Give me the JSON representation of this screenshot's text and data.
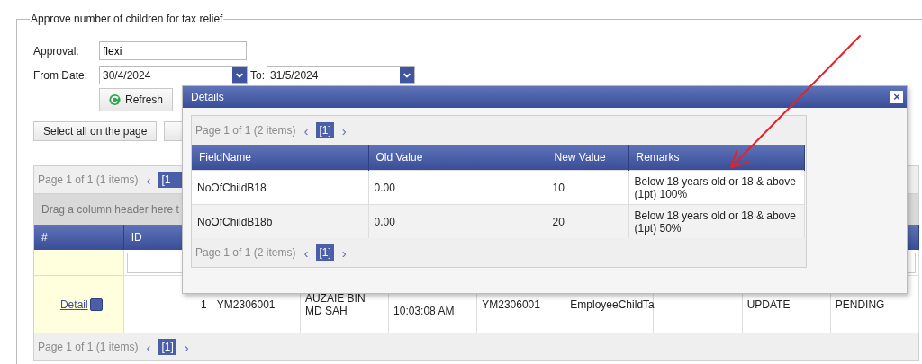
{
  "fieldset": {
    "legend": "Approve number of children for tax relief"
  },
  "form": {
    "approval_label": "Approval:",
    "approval_value": "flexi",
    "from_label": "From Date:",
    "from_value": "30/4/2024",
    "to_label": "To:",
    "to_value": "31/5/2024",
    "refresh": "Refresh"
  },
  "buttons": [
    "Select all on the page"
  ],
  "grid": {
    "pager_top": {
      "summary": "Page 1 of 1 (1 items)",
      "prev": "‹",
      "pages": [
        {
          "label": "[1",
          "selected": true
        }
      ]
    },
    "group_panel": "Drag a column header here t",
    "columns": [
      "#",
      "ID"
    ],
    "rows": [
      {
        "detail_link": "Detail",
        "cells": {
          "column_2": "1",
          "column_3": "YM2306001",
          "column_4": "AUZAIE BIN MD SAH",
          "column_5": "10:03:08 AM",
          "column_6": "YM2306001",
          "column_7": "EmployeeChildTa",
          "column_9": "UPDATE",
          "column_10": "PENDING"
        }
      }
    ],
    "pager_bottom": {
      "summary": "Page 1 of 1 (1 items)",
      "prev": "‹",
      "next": "›",
      "pages": [
        {
          "label": "[1]",
          "selected": true
        }
      ]
    }
  },
  "dialog": {
    "title": "Details",
    "close": "×",
    "pager_top": {
      "summary": "Page 1 of 1 (2 items)",
      "prev": "‹",
      "next": "›",
      "pages": [
        {
          "label": "[1]",
          "selected": true
        }
      ]
    },
    "columns": [
      "FieldName",
      "Old Value",
      "New Value",
      "Remarks"
    ],
    "rows": [
      [
        "NoOfChildB18",
        "0.00",
        "10",
        "Below 18 years old or 18 & above (1pt) 100%"
      ],
      [
        "NoOfChildB18b",
        "0.00",
        "20",
        "Below 18 years old or 18 & above (1pt) 50%"
      ]
    ],
    "pager_bottom": {
      "summary": "Page 1 of 1 (2 items)",
      "prev": "‹",
      "next": "›",
      "pages": [
        {
          "label": "[1]",
          "selected": true
        }
      ]
    }
  }
}
